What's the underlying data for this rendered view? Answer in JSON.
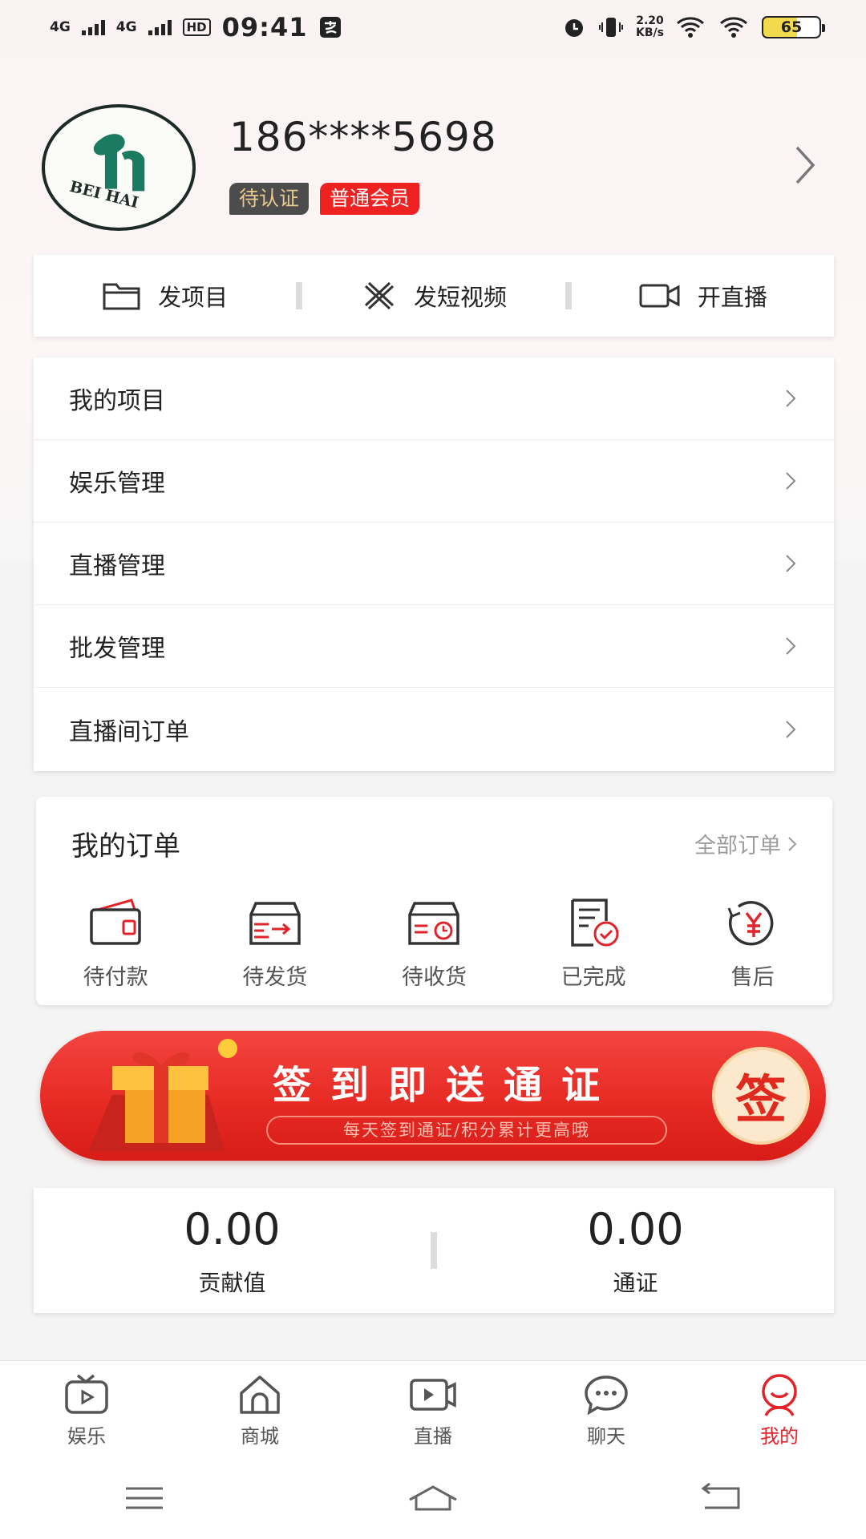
{
  "status_bar": {
    "net1": "4G",
    "net2": "4G",
    "hd": "HD",
    "time": "09:41",
    "speed_value": "2.20",
    "speed_unit": "KB/s",
    "battery": "65"
  },
  "profile": {
    "phone": "186****5698",
    "tag_status": "待认证",
    "tag_member": "普通会员"
  },
  "quick_actions": [
    {
      "label": "发项目",
      "icon": "folder-icon"
    },
    {
      "label": "发短视频",
      "icon": "video-edit-icon"
    },
    {
      "label": "开直播",
      "icon": "camera-icon"
    }
  ],
  "menu": [
    {
      "label": "我的项目"
    },
    {
      "label": "娱乐管理"
    },
    {
      "label": "直播管理"
    },
    {
      "label": "批发管理"
    },
    {
      "label": "直播间订单"
    }
  ],
  "orders": {
    "title": "我的订单",
    "all_label": "全部订单",
    "items": [
      {
        "label": "待付款",
        "icon": "wallet-icon"
      },
      {
        "label": "待发货",
        "icon": "shipping-box-icon"
      },
      {
        "label": "待收货",
        "icon": "receive-box-icon"
      },
      {
        "label": "已完成",
        "icon": "completed-doc-icon"
      },
      {
        "label": "售后",
        "icon": "refund-icon"
      }
    ]
  },
  "banner": {
    "title": "签到即送通证",
    "subtitle": "每天签到通证/积分累计更高哦",
    "button": "签"
  },
  "stats": [
    {
      "value": "0.00",
      "label": "贡献值"
    },
    {
      "value": "0.00",
      "label": "通证"
    }
  ],
  "tabs": [
    {
      "label": "娱乐",
      "icon": "tv-icon"
    },
    {
      "label": "商城",
      "icon": "home-icon"
    },
    {
      "label": "直播",
      "icon": "live-icon"
    },
    {
      "label": "聊天",
      "icon": "chat-icon"
    },
    {
      "label": "我的",
      "icon": "profile-icon",
      "active": true
    }
  ],
  "colors": {
    "accent": "#e2232a",
    "tag_gray": "#4c4c4c",
    "tag_gold_text": "#e9c98d"
  }
}
